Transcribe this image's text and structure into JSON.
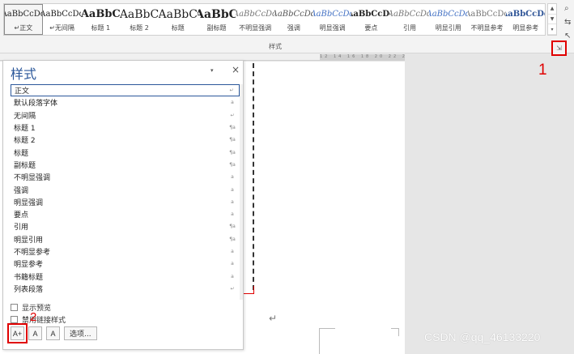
{
  "ribbon": {
    "gallery": [
      {
        "preview": "AaBbCcDd",
        "name": "正文",
        "selected": true,
        "size": 10,
        "bold": false,
        "italic": false,
        "color": "#222222",
        "mark": "↵"
      },
      {
        "preview": "AaBbCcDd",
        "name": "无间隔",
        "selected": false,
        "size": 10,
        "bold": false,
        "italic": false,
        "color": "#222222",
        "mark": "↵"
      },
      {
        "preview": "AaBbC",
        "name": "标题 1",
        "selected": false,
        "size": 13,
        "bold": true,
        "italic": false,
        "color": "#222222",
        "mark": ""
      },
      {
        "preview": "AaBbC",
        "name": "标题 2",
        "selected": false,
        "size": 14,
        "bold": false,
        "italic": false,
        "color": "#222222",
        "mark": ""
      },
      {
        "preview": "AaBbC",
        "name": "标题",
        "selected": false,
        "size": 14,
        "bold": false,
        "italic": false,
        "color": "#222222",
        "mark": ""
      },
      {
        "preview": "AaBbC",
        "name": "副标题",
        "selected": false,
        "size": 14,
        "bold": true,
        "italic": false,
        "color": "#222222",
        "mark": ""
      },
      {
        "preview": "AaBbCcDd",
        "name": "不明显强调",
        "selected": false,
        "size": 10,
        "bold": false,
        "italic": true,
        "color": "#777777",
        "mark": ""
      },
      {
        "preview": "AaBbCcDd",
        "name": "强调",
        "selected": false,
        "size": 10,
        "bold": false,
        "italic": true,
        "color": "#555555",
        "mark": ""
      },
      {
        "preview": "AaBbCcDd",
        "name": "明显强调",
        "selected": false,
        "size": 10,
        "bold": false,
        "italic": true,
        "color": "#4472c4",
        "mark": ""
      },
      {
        "preview": "AaBbCcDd",
        "name": "要点",
        "selected": false,
        "size": 10,
        "bold": true,
        "italic": false,
        "color": "#222222",
        "mark": ""
      },
      {
        "preview": "AaBbCcDd",
        "name": "引用",
        "selected": false,
        "size": 10,
        "bold": false,
        "italic": true,
        "color": "#777777",
        "mark": ""
      },
      {
        "preview": "AaBbCcDd",
        "name": "明显引用",
        "selected": false,
        "size": 10,
        "bold": false,
        "italic": true,
        "color": "#4472c4",
        "mark": ""
      },
      {
        "preview": "AaBbCcDd",
        "name": "不明显参考",
        "selected": false,
        "size": 10,
        "bold": false,
        "italic": false,
        "color": "#777777",
        "mark": ""
      },
      {
        "preview": "AaBbCcDd",
        "name": "明显参考",
        "selected": false,
        "size": 10,
        "bold": true,
        "italic": false,
        "color": "#2f5597",
        "mark": ""
      }
    ],
    "group_label": "样式",
    "scroll_up": "▲",
    "scroll_down": "▼",
    "more": "▾",
    "launcher_icon": "⇲",
    "find_icon": "⌕",
    "replace_icon": "⇆",
    "select_icon": "↖"
  },
  "annotations": {
    "one": "1",
    "two": "2"
  },
  "ruler_ticks": "12 14 16 18 20 22 24 26 28 30 32",
  "document": {
    "paragraph_mark": "↵",
    "watermark": "CSDN @qq_46133220"
  },
  "styles_pane": {
    "title": "样式",
    "dropdown": "▾",
    "close": "×",
    "items": [
      {
        "label": "正文",
        "kind": "↵",
        "selected": true
      },
      {
        "label": "默认段落字体",
        "kind": "a",
        "selected": false
      },
      {
        "label": "无间隔",
        "kind": "↵",
        "selected": false
      },
      {
        "label": "标题 1",
        "kind": "¶a",
        "selected": false
      },
      {
        "label": "标题 2",
        "kind": "¶a",
        "selected": false
      },
      {
        "label": "标题",
        "kind": "¶a",
        "selected": false
      },
      {
        "label": "副标题",
        "kind": "¶a",
        "selected": false
      },
      {
        "label": "不明显强调",
        "kind": "a",
        "selected": false
      },
      {
        "label": "强调",
        "kind": "a",
        "selected": false
      },
      {
        "label": "明显强调",
        "kind": "a",
        "selected": false
      },
      {
        "label": "要点",
        "kind": "a",
        "selected": false
      },
      {
        "label": "引用",
        "kind": "¶a",
        "selected": false
      },
      {
        "label": "明显引用",
        "kind": "¶a",
        "selected": false
      },
      {
        "label": "不明显参考",
        "kind": "a",
        "selected": false
      },
      {
        "label": "明显参考",
        "kind": "a",
        "selected": false
      },
      {
        "label": "书籍标题",
        "kind": "a",
        "selected": false
      },
      {
        "label": "列表段落",
        "kind": "↵",
        "selected": false
      }
    ],
    "show_preview_label": "显示预览",
    "disable_linked_label": "禁用链接样式",
    "new_style_icon": "A+",
    "inspector_icon": "A",
    "manage_icon": "A",
    "options_label": "选项..."
  }
}
